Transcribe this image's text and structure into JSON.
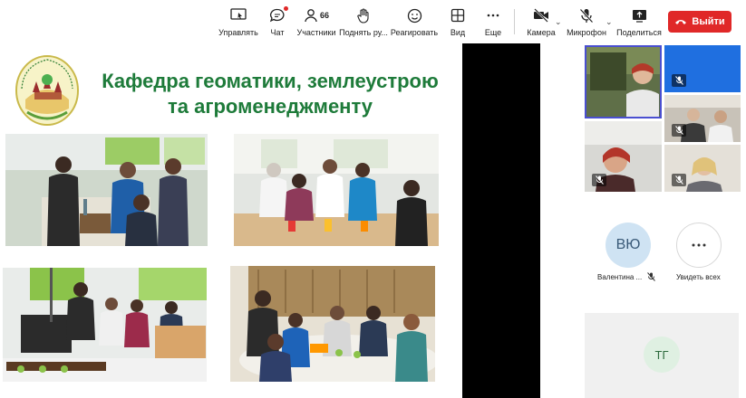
{
  "toolbar": {
    "manage": "Управлять",
    "chat": "Чат",
    "participants": "Участники",
    "participants_count": "66",
    "raise_hand": "Поднять ру...",
    "react": "Реагировать",
    "view": "Вид",
    "more": "Еще",
    "camera": "Камера",
    "mic": "Микрофон",
    "share": "Поделиться",
    "leave": "Выйти"
  },
  "slide": {
    "title_line1": "Кафедра геоматики, землеустрою",
    "title_line2": "та агроменеджменту",
    "logo_text": "Geomatics, Land and AgroManagement"
  },
  "participants": {
    "vyu_initials": "ВЮ",
    "vyu_name": "Валентина ...",
    "see_all": "Увидеть всех",
    "tg_initials": "ТГ"
  },
  "colors": {
    "title_green": "#1e7b3a",
    "leave_red": "#e02828",
    "active_border": "#4a4fd0"
  }
}
